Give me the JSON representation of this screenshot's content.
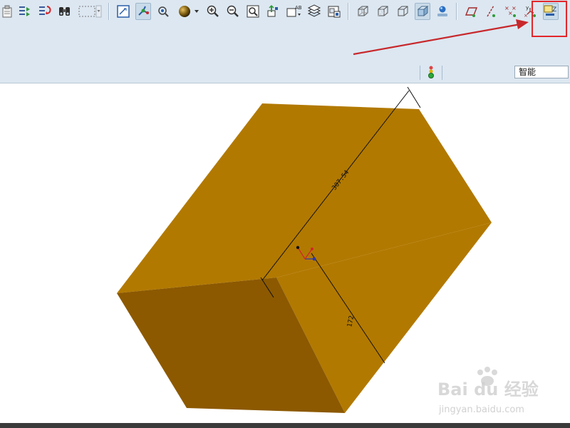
{
  "toolbar": {
    "icons": [
      "paste-icon",
      "copy-regenerate-icon",
      "regenerate-icon",
      "find-icon",
      "select-box-icon",
      "redraw-icon",
      "spin-center-icon",
      "orient-mode-icon",
      "appearance-sphere-icon",
      "zoom-in-icon",
      "zoom-out-icon",
      "refit-icon",
      "reorient-icon",
      "annotation-display-icon",
      "layers-icon",
      "saved-views-icon",
      "wireframe-icon",
      "hidden-line-icon",
      "no-hidden-icon",
      "shading-icon",
      "model-tree-display-icon",
      "datum-plane-display-icon",
      "datum-axis-display-icon",
      "datum-point-display-icon",
      "csys-display-icon",
      "annotation-plane-display-icon"
    ],
    "selection_filter": "智能"
  },
  "colors": {
    "toolbar_bg": "#dce7f1",
    "box_top": "#b27900",
    "box_front": "#8c5900",
    "highlight": "#e2262b",
    "arrow": "#c8282c"
  },
  "model": {
    "dimensions": [
      "307.54",
      "172"
    ]
  },
  "watermark": {
    "brand": "Bai du 经验",
    "url": "jingyan.baidu.com"
  }
}
